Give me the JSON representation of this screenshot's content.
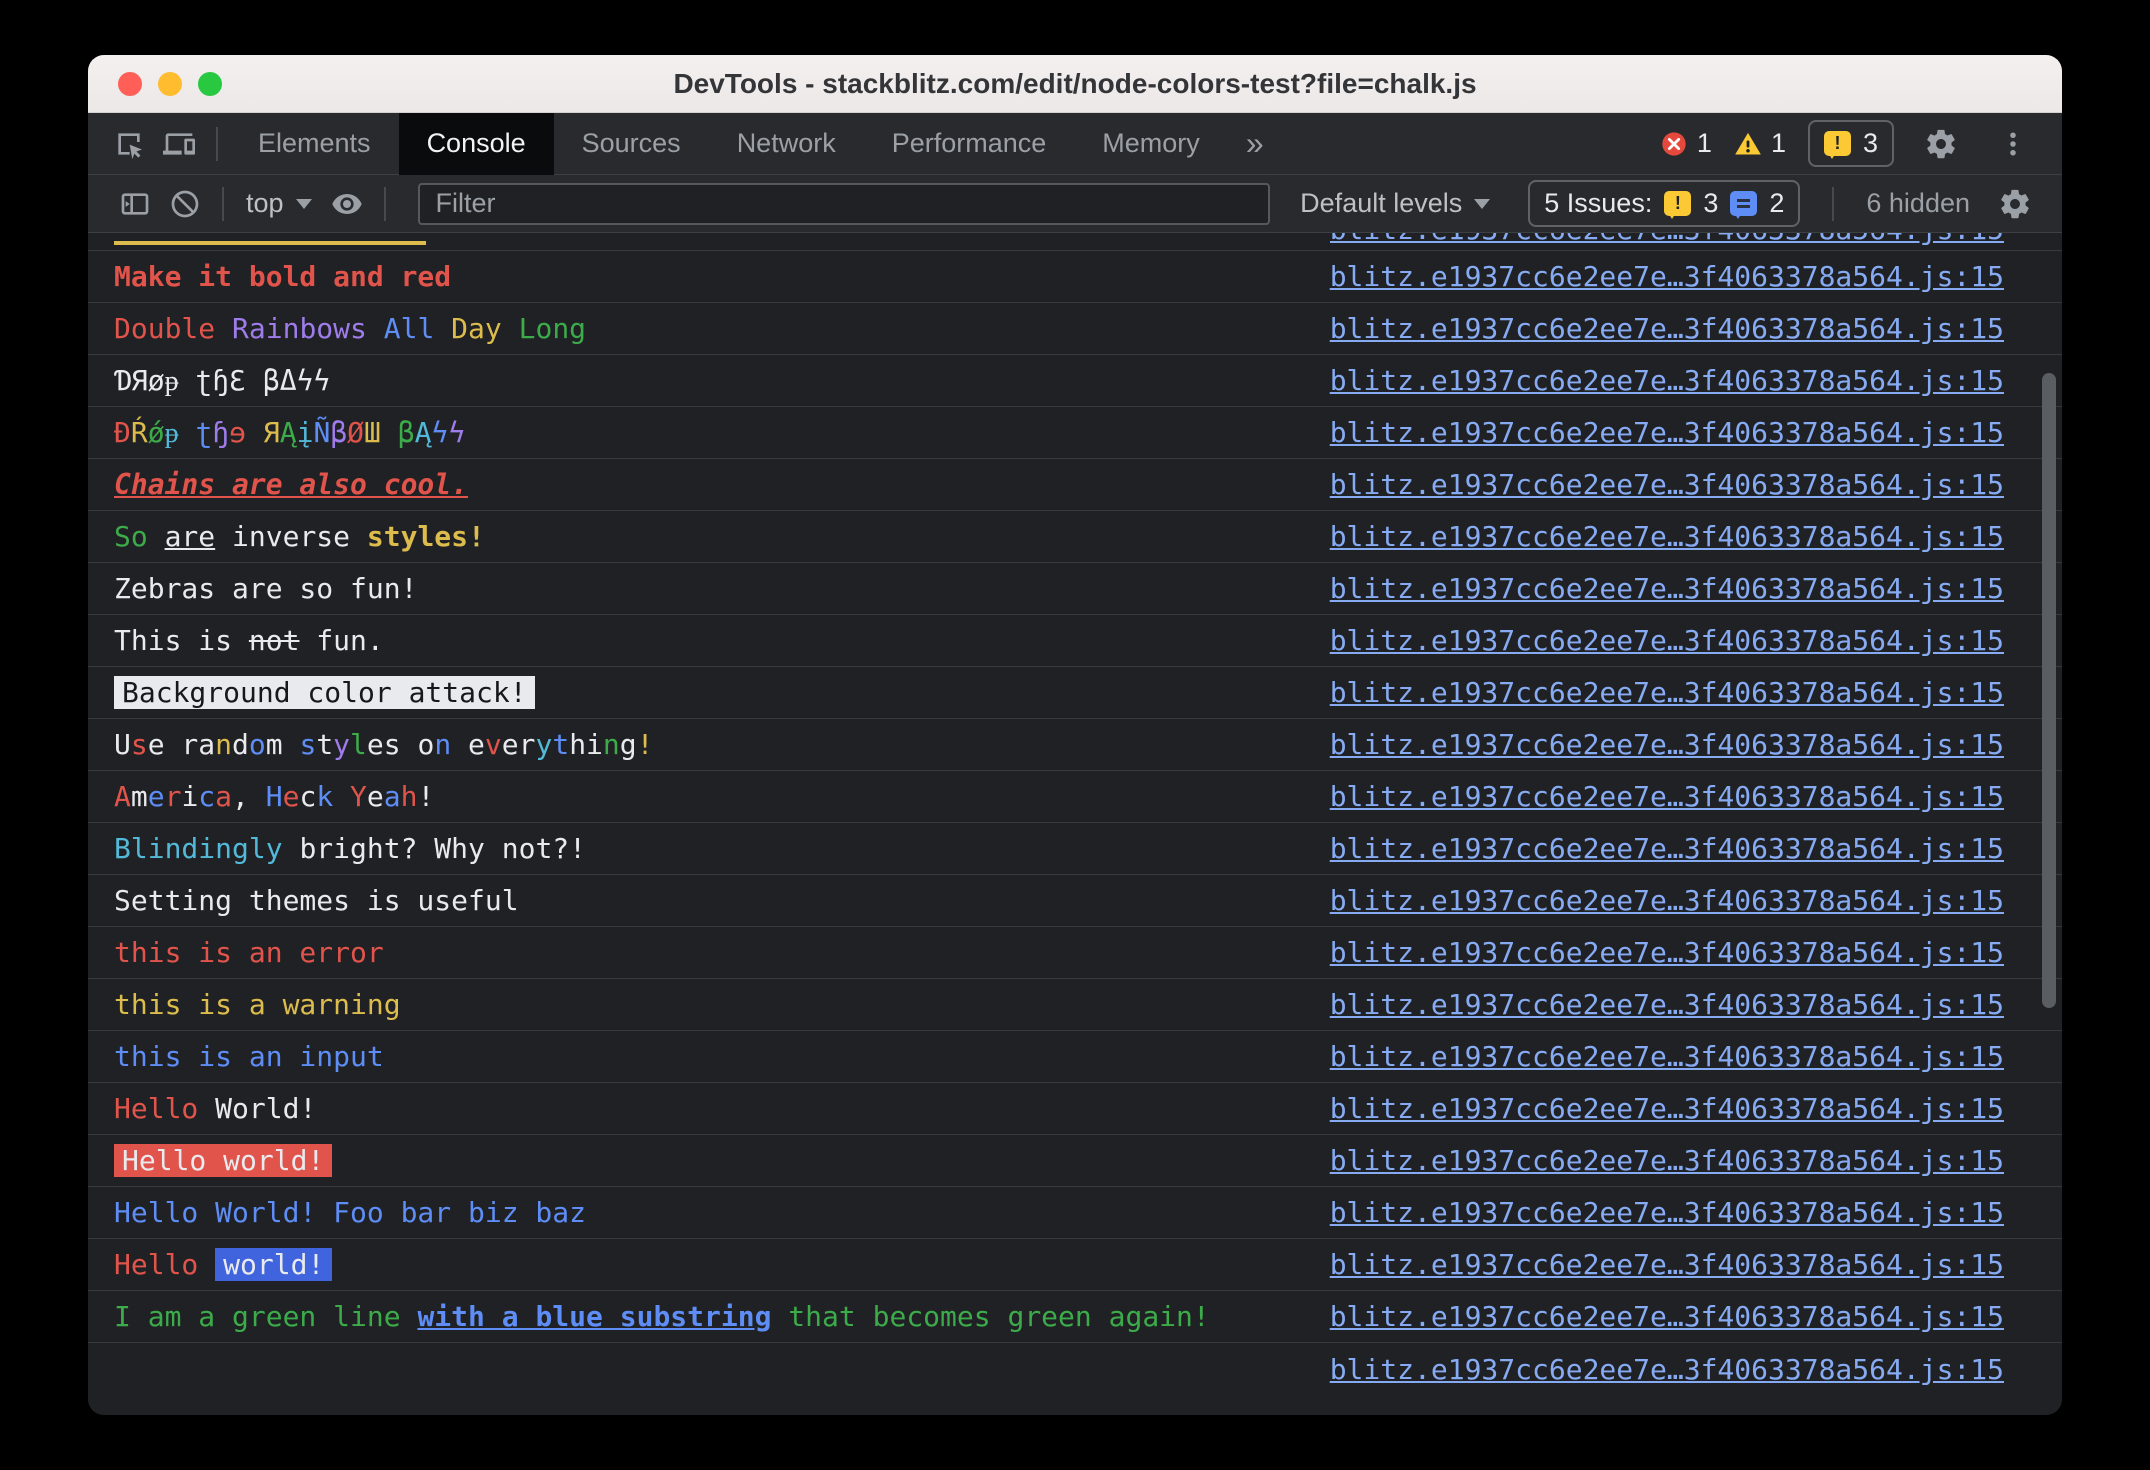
{
  "titlebar": {
    "title": "DevTools - stackblitz.com/edit/node-colors-test?file=chalk.js"
  },
  "tabbar": {
    "tabs": [
      {
        "label": "Elements"
      },
      {
        "label": "Console",
        "active": true
      },
      {
        "label": "Sources"
      },
      {
        "label": "Network"
      },
      {
        "label": "Performance"
      },
      {
        "label": "Memory"
      }
    ],
    "more": "»",
    "error_count": "1",
    "warning_count": "1",
    "issue_count": "3"
  },
  "filterbar": {
    "context": "top",
    "filter_placeholder": "Filter",
    "levels": "Default levels",
    "issues_label": "5 Issues:",
    "issues_yellow": "3",
    "issues_blue": "2",
    "hidden_label": "6 hidden"
  },
  "icons": [
    "inspect-icon",
    "device-toolbar-icon",
    "error-icon",
    "warning-icon",
    "issues-bubble-icon",
    "gear-icon",
    "kebab-menu-icon",
    "console-sidebar-icon",
    "clear-console-icon",
    "eye-icon",
    "chevron-down-icon",
    "close-icon",
    "minimize-icon",
    "zoom-icon"
  ],
  "colors": {
    "traffic_close": "#ff5f57",
    "traffic_minimize": "#febc2e",
    "traffic_zoom": "#28c840",
    "toolbar_bg": "#292a2d",
    "console_bg": "#202124",
    "error_red": "#e5493d",
    "warning_yellow": "#fbc934"
  },
  "console": {
    "source_link": "blitz.e1937cc6e2ee7e…3f4063378a564.js:15",
    "palette": {
      "white": "#e8eaed",
      "red": "#e1544b",
      "green": "#3cab4a",
      "yellow": "#dcbc4c",
      "blue": "#5d8df5",
      "purple": "#9e7cea",
      "cyan": "#53b9d9",
      "dark": "#17181a",
      "blue_bg": "#4064dd",
      "link": "#87abf3"
    },
    "rows": [
      {
        "segments": [
          {
            "t": "Make it bold and red",
            "c": "red",
            "b": true
          }
        ]
      },
      {
        "segments": [
          {
            "t": "Double ",
            "c": "red"
          },
          {
            "t": "Rainbows ",
            "c": "purple"
          },
          {
            "t": "All ",
            "c": "blue"
          },
          {
            "t": "Day ",
            "c": "yellow"
          },
          {
            "t": "Long",
            "c": "green"
          }
        ]
      },
      {
        "segments": [
          {
            "t": "ƊЯøᵽ ʈɧƐ βΔϟϟ"
          }
        ]
      },
      {
        "segments": [
          {
            "t": "Ɖ",
            "c": "red"
          },
          {
            "t": "Ŕ",
            "c": "yellow"
          },
          {
            "t": "ǿ",
            "c": "green"
          },
          {
            "t": "ᵽ",
            "c": "cyan"
          },
          {
            "t": " "
          },
          {
            "t": "ʈ",
            "c": "blue"
          },
          {
            "t": "ɧ",
            "c": "purple"
          },
          {
            "t": "ɘ",
            "c": "red"
          },
          {
            "t": " "
          },
          {
            "t": "Я",
            "c": "yellow"
          },
          {
            "t": "Ą",
            "c": "green"
          },
          {
            "t": "į",
            "c": "cyan"
          },
          {
            "t": "Ñ",
            "c": "blue"
          },
          {
            "t": "β",
            "c": "purple"
          },
          {
            "t": "Ø",
            "c": "red"
          },
          {
            "t": "Ш",
            "c": "yellow"
          },
          {
            "t": " "
          },
          {
            "t": "β",
            "c": "green"
          },
          {
            "t": "Ą",
            "c": "cyan"
          },
          {
            "t": "ϟ",
            "c": "blue"
          },
          {
            "t": "ϟ",
            "c": "purple"
          }
        ]
      },
      {
        "segments": [
          {
            "t": "Chains are also cool.",
            "c": "red",
            "b": true,
            "i": true,
            "u": true
          }
        ]
      },
      {
        "segments": [
          {
            "t": "So ",
            "c": "green"
          },
          {
            "t": "are",
            "u": true
          },
          {
            "t": " inverse "
          },
          {
            "t": "styles!",
            "c": "yellow",
            "b": true
          }
        ]
      },
      {
        "segments": [
          {
            "t": "Zebras are so fun!"
          }
        ]
      },
      {
        "segments": [
          {
            "t": "This is "
          },
          {
            "t": "not",
            "s": true
          },
          {
            "t": " fun."
          }
        ]
      },
      {
        "segments": [
          {
            "t": "Background color attack!",
            "c": "dark",
            "bg": "white"
          }
        ]
      },
      {
        "segments": [
          {
            "t": "U"
          },
          {
            "t": "s",
            "c": "red"
          },
          {
            "t": "e ra"
          },
          {
            "t": "n",
            "c": "yellow"
          },
          {
            "t": "d"
          },
          {
            "t": "o",
            "c": "blue"
          },
          {
            "t": "m "
          },
          {
            "t": "s",
            "c": "blue"
          },
          {
            "t": "t"
          },
          {
            "t": "y",
            "c": "purple"
          },
          {
            "t": "l",
            "c": "green"
          },
          {
            "t": "es "
          },
          {
            "t": "o"
          },
          {
            "t": "n",
            "c": "blue"
          },
          {
            "t": " e"
          },
          {
            "t": "v",
            "c": "red"
          },
          {
            "t": "er"
          },
          {
            "t": "y",
            "c": "cyan"
          },
          {
            "t": "t",
            "c": "blue"
          },
          {
            "t": "hi"
          },
          {
            "t": "n",
            "c": "green"
          },
          {
            "t": "g"
          },
          {
            "t": "!",
            "c": "yellow"
          }
        ]
      },
      {
        "segments": [
          {
            "t": "A",
            "c": "red"
          },
          {
            "t": "m"
          },
          {
            "t": "e",
            "c": "blue"
          },
          {
            "t": "r",
            "c": "red"
          },
          {
            "t": "i"
          },
          {
            "t": "c",
            "c": "blue"
          },
          {
            "t": "a",
            "c": "red"
          },
          {
            "t": ", "
          },
          {
            "t": "H",
            "c": "blue"
          },
          {
            "t": "e",
            "c": "red"
          },
          {
            "t": "c"
          },
          {
            "t": "k",
            "c": "blue"
          },
          {
            "t": " "
          },
          {
            "t": "Y",
            "c": "red"
          },
          {
            "t": "e"
          },
          {
            "t": "a",
            "c": "blue"
          },
          {
            "t": "h",
            "c": "red"
          },
          {
            "t": "!"
          }
        ]
      },
      {
        "segments": [
          {
            "t": "Blindingly ",
            "c": "cyan"
          },
          {
            "t": "bright? Why not?!"
          }
        ]
      },
      {
        "segments": [
          {
            "t": "Setting themes is useful"
          }
        ]
      },
      {
        "segments": [
          {
            "t": "this is an error",
            "c": "red"
          }
        ]
      },
      {
        "segments": [
          {
            "t": "this is a warning",
            "c": "yellow"
          }
        ]
      },
      {
        "segments": [
          {
            "t": "this is an input",
            "c": "blue"
          }
        ]
      },
      {
        "segments": [
          {
            "t": "Hello ",
            "c": "red"
          },
          {
            "t": "World!"
          }
        ]
      },
      {
        "segments": [
          {
            "t": "Hello world!",
            "bg": "red"
          }
        ]
      },
      {
        "segments": [
          {
            "t": "Hello World! Foo bar biz baz",
            "c": "blue"
          }
        ]
      },
      {
        "segments": [
          {
            "t": "Hello ",
            "c": "red"
          },
          {
            "t": "world!",
            "bg": "blue_bg"
          }
        ]
      },
      {
        "segments": [
          {
            "t": "I am a green line ",
            "c": "green"
          },
          {
            "t": "with a blue substring",
            "c": "blue",
            "b": true,
            "u": true
          },
          {
            "t": " that becomes green again!",
            "c": "green"
          }
        ]
      },
      {
        "segments": [],
        "noborder": true
      }
    ]
  }
}
